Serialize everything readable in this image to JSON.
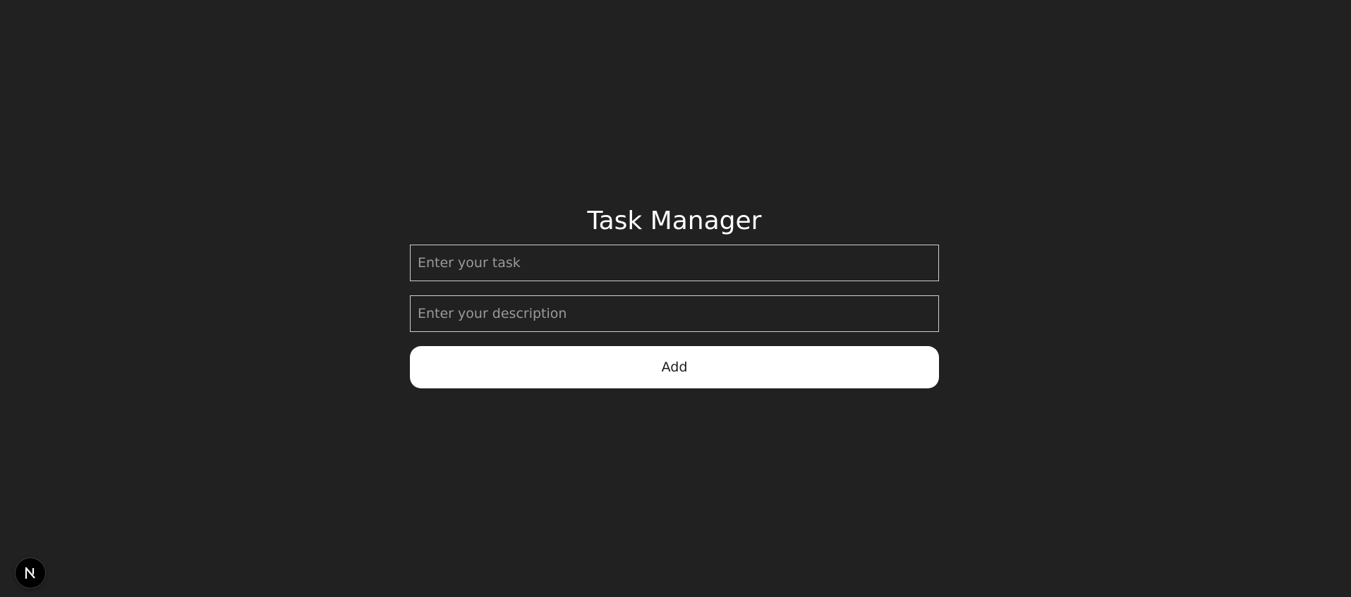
{
  "header": {
    "title": "Task Manager"
  },
  "form": {
    "task_placeholder": "Enter your task",
    "task_value": "",
    "description_placeholder": "Enter your description",
    "description_value": "",
    "add_label": "Add"
  },
  "dev_indicator": {
    "icon": "nextjs-logo-icon"
  },
  "colors": {
    "background": "#212121",
    "title": "#ffffff",
    "input_border": "#cfcfcf",
    "placeholder": "#9a9a9a",
    "button_bg": "#ffffff",
    "button_text": "#1a1a1a"
  }
}
